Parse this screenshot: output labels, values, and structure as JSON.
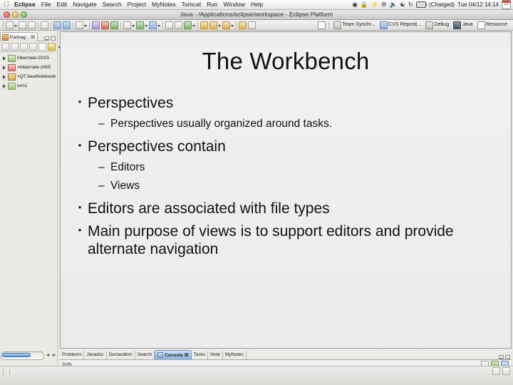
{
  "menubar": {
    "apple_icon": "apple-logo",
    "items": [
      {
        "label": "Eclipse",
        "bold": true
      },
      {
        "label": "File"
      },
      {
        "label": "Edit"
      },
      {
        "label": "Navigate"
      },
      {
        "label": "Search"
      },
      {
        "label": "Project"
      },
      {
        "label": "MyNotes"
      },
      {
        "label": "Tomcat"
      },
      {
        "label": "Run"
      },
      {
        "label": "Window"
      },
      {
        "label": "Help"
      }
    ],
    "status_icons": [
      "time-machine-icon",
      "lock-icon",
      "bluetooth-icon",
      "volume-icon",
      "wifi-icon",
      "sync-icon"
    ],
    "battery_label": "(Charged)",
    "clock": "Tue 04/12 14:14",
    "calendar_day": "12"
  },
  "window": {
    "title": "Java - /Applications/eclipse/workspace - Eclipse Platform"
  },
  "perspective_bar": {
    "items": [
      {
        "label": "Team Synchr..."
      },
      {
        "label": "CVS Reposit..."
      },
      {
        "label": "Debug"
      },
      {
        "label": "Java"
      },
      {
        "label": "Resource"
      }
    ]
  },
  "explorer": {
    "tab_label": "Packag...",
    "tab_close": "☒",
    "tree": [
      {
        "label": "hibernate-Ch03",
        "icon": "project-folder-icon"
      },
      {
        "label": ">hibernate-ch05",
        "icon": "project-folder-icon"
      },
      {
        "label": ">QTJavaNotebook",
        "icon": "project-folder-icon"
      },
      {
        "label": "tom1",
        "icon": "project-folder-icon"
      }
    ]
  },
  "slide": {
    "title": "The Workbench",
    "bullets": [
      {
        "level": 1,
        "marker": "•",
        "text": "Perspectives"
      },
      {
        "level": 2,
        "marker": "–",
        "text": "Perspectives usually organized around tasks."
      },
      {
        "level": 1,
        "marker": "•",
        "text": "Perspectives contain"
      },
      {
        "level": 2,
        "marker": "–",
        "text": " Editors"
      },
      {
        "level": 2,
        "marker": "–",
        "text": "Views"
      },
      {
        "level": 1,
        "marker": "•",
        "text": "Editors are associated with file types"
      },
      {
        "level": 1,
        "marker": "•",
        "text": "Main purpose of views is to support editors and provide alternate navigation"
      }
    ]
  },
  "bottom_panel": {
    "tabs": [
      {
        "label": "Problems",
        "active": false
      },
      {
        "label": "Javadoc",
        "active": false
      },
      {
        "label": "Declaration",
        "active": false
      },
      {
        "label": "Search",
        "active": false
      },
      {
        "label": "Console",
        "active": true
      },
      {
        "label": "Tasks",
        "active": false
      },
      {
        "label": "Note",
        "active": false
      },
      {
        "label": "MyNotes",
        "active": false
      }
    ],
    "console_label": "SVN"
  },
  "colors": {
    "slide_bg": "#eeeeee",
    "active_tab": "#8ab4e4",
    "chrome": "#eceae6",
    "text": "#111111"
  }
}
